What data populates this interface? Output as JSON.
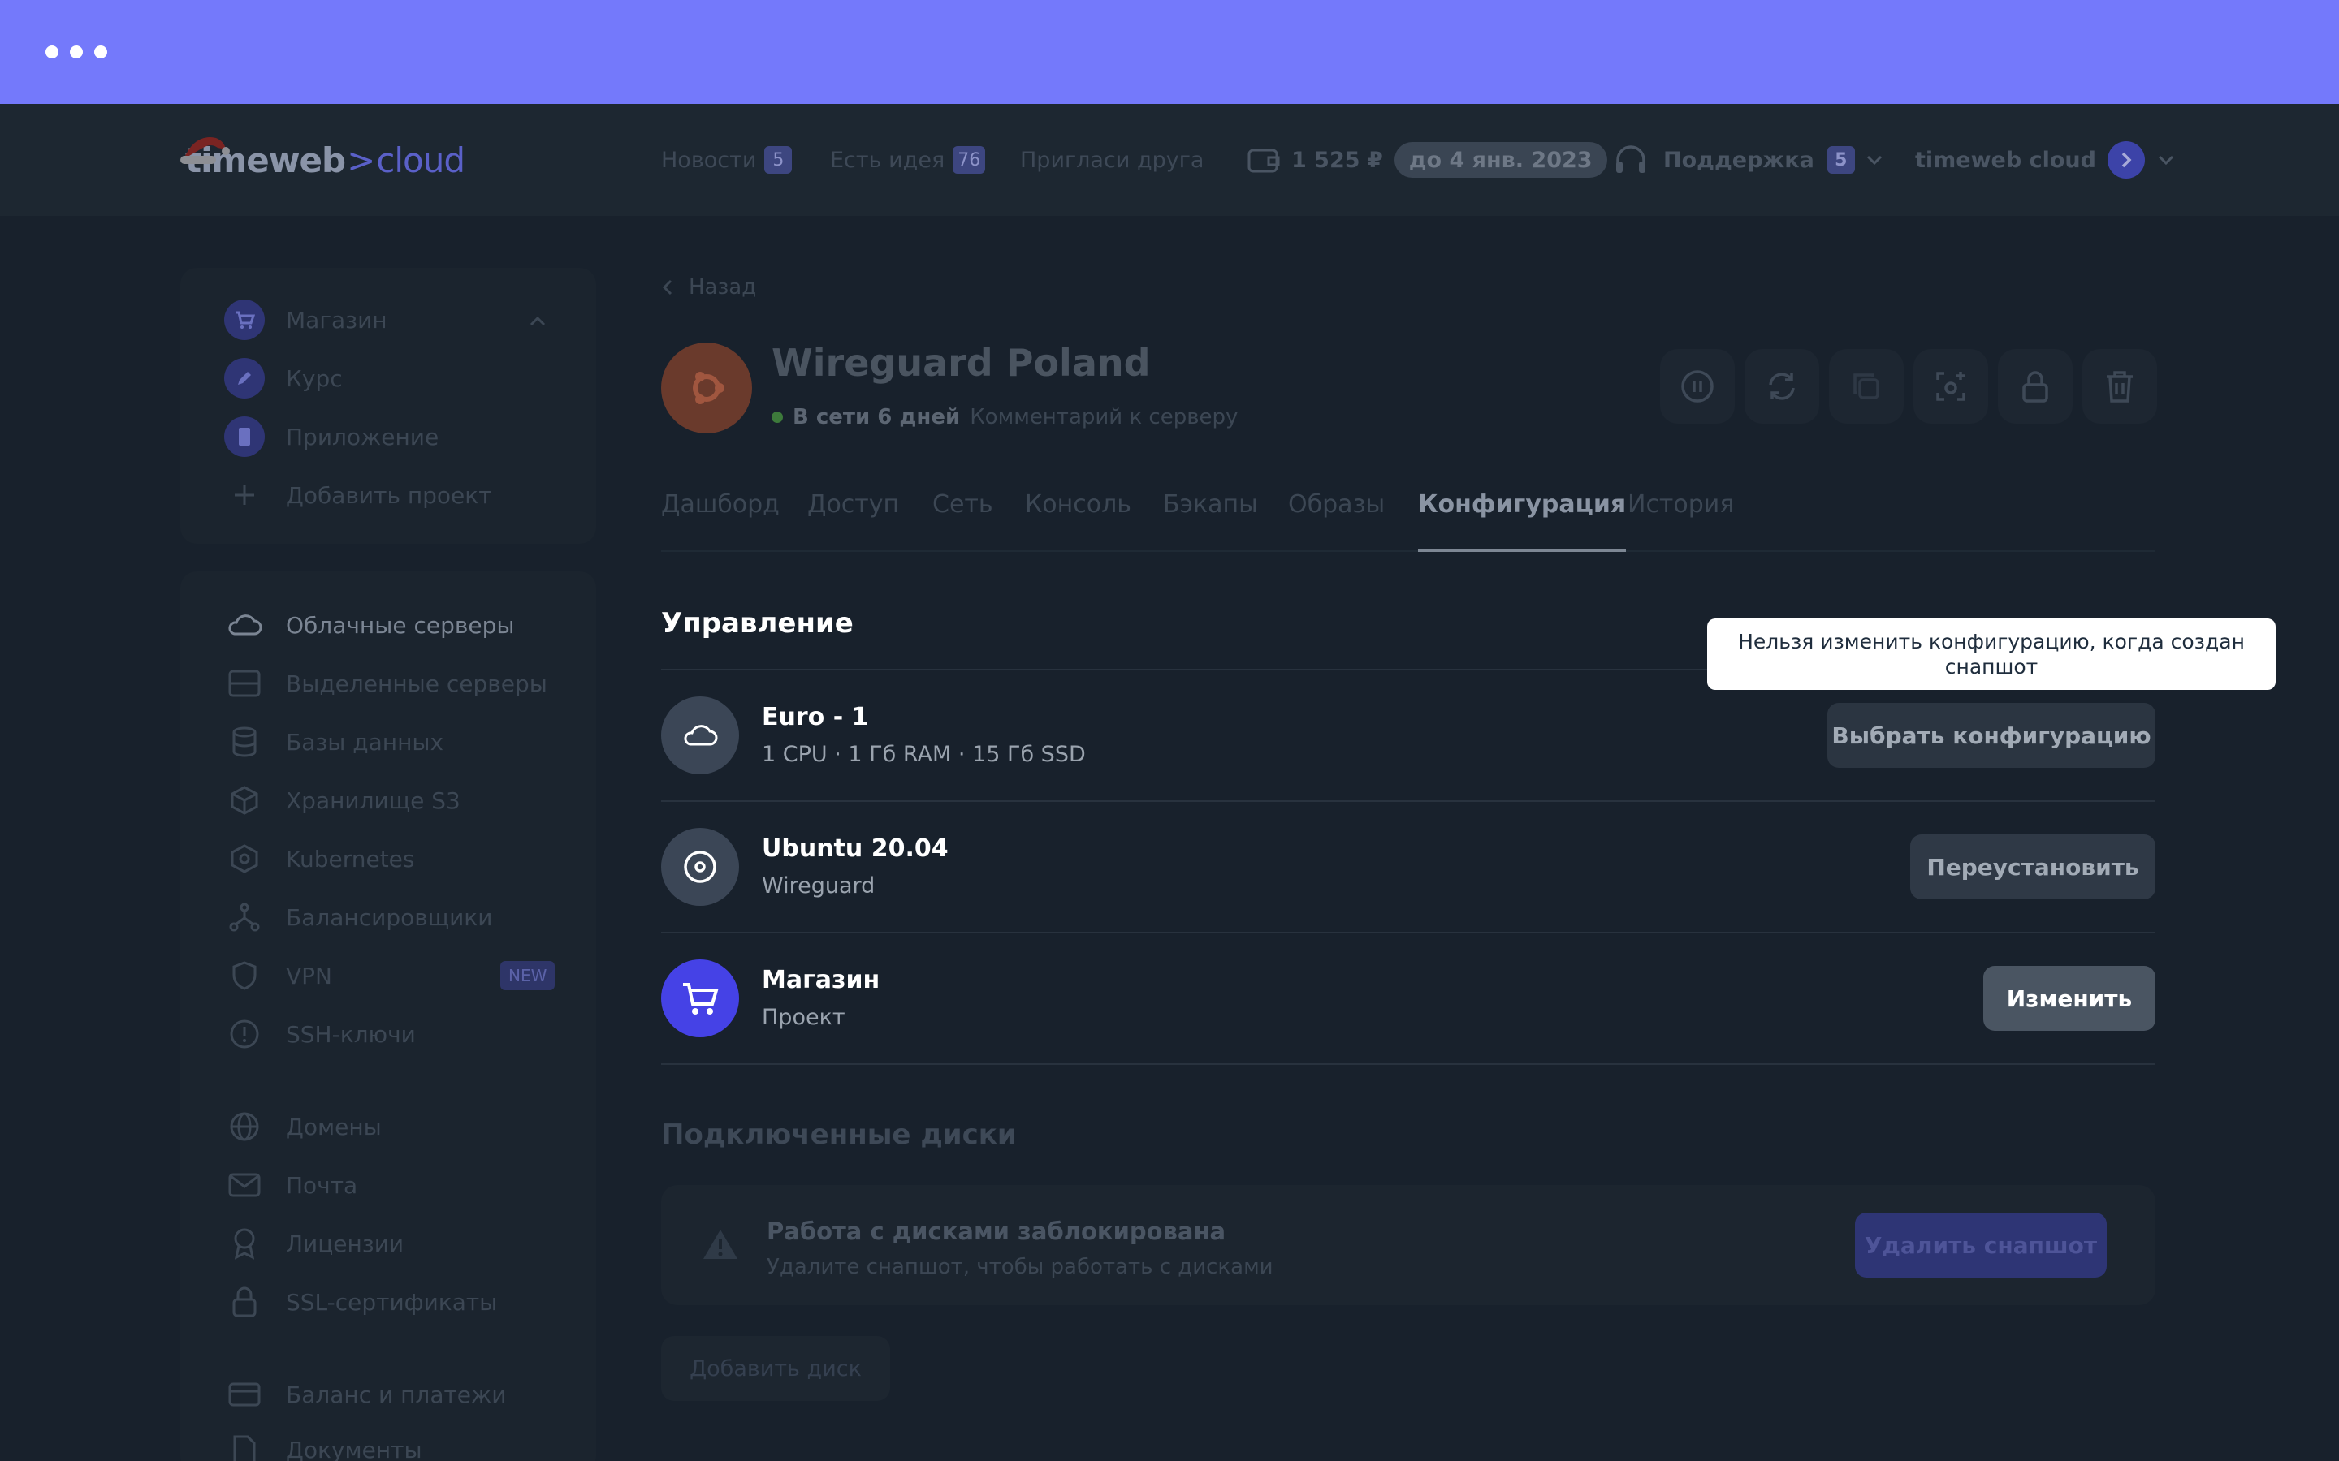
{
  "header": {
    "logo_left": "timeweb",
    "logo_sep": ">",
    "logo_right": "cloud",
    "nav": [
      {
        "label": "Новости",
        "badge": "5"
      },
      {
        "label": "Есть идея",
        "badge": "76"
      },
      {
        "label": "Пригласи друга"
      }
    ],
    "balance": "1 525 ₽",
    "balance_until": "до 4 янв. 2023",
    "support_label": "Поддержка",
    "support_badge": "5",
    "account_label": "timeweb cloud"
  },
  "sidebar": {
    "projects": [
      {
        "label": "Магазин"
      },
      {
        "label": "Курс"
      },
      {
        "label": "Приложение"
      },
      {
        "label": "Добавить проект"
      }
    ],
    "services": [
      {
        "label": "Облачные серверы"
      },
      {
        "label": "Выделенные серверы"
      },
      {
        "label": "Базы данных"
      },
      {
        "label": "Хранилище S3"
      },
      {
        "label": "Kubernetes"
      },
      {
        "label": "Балансировщики"
      },
      {
        "label": "VPN",
        "badge": "NEW"
      },
      {
        "label": "SSH-ключи"
      },
      {
        "label": "Домены"
      },
      {
        "label": "Почта"
      },
      {
        "label": "Лицензии"
      },
      {
        "label": "SSL-сертификаты"
      },
      {
        "label": "Баланс и платежи"
      },
      {
        "label": "Документы"
      }
    ]
  },
  "server": {
    "back_label": "Назад",
    "name": "Wireguard Poland",
    "status": "В сети 6 дней",
    "comment": "Комментарий к серверу"
  },
  "tabs": [
    {
      "label": "Дашборд"
    },
    {
      "label": "Доступ"
    },
    {
      "label": "Сеть"
    },
    {
      "label": "Консоль"
    },
    {
      "label": "Бэкапы"
    },
    {
      "label": "Образы"
    },
    {
      "label": "Конфигурация",
      "active": true
    },
    {
      "label": "История"
    }
  ],
  "management": {
    "title": "Управление",
    "tooltip": "Нельзя изменить конфигурацию, когда создан снапшот",
    "rows": [
      {
        "name": "Euro - 1",
        "sub": "1 CPU · 1 Гб RAM · 15 Гб SSD",
        "action": "Выбрать конфигурацию"
      },
      {
        "name": "Ubuntu 20.04",
        "sub": "Wireguard",
        "action": "Переустановить"
      },
      {
        "name": "Магазин",
        "sub": "Проект",
        "action": "Изменить"
      }
    ]
  },
  "disks": {
    "title": "Подключенные диски",
    "locked_title": "Работа с дисками заблокирована",
    "locked_sub": "Удалите снапшот, чтобы работать с дисками",
    "delete_snapshot": "Удалить снапшот",
    "add_disk": "Добавить диск"
  },
  "colors": {
    "browser_bar": "#7479fb",
    "page_bg": "#18212c",
    "accent": "#4542e6",
    "status_online": "#3d7a3b"
  }
}
